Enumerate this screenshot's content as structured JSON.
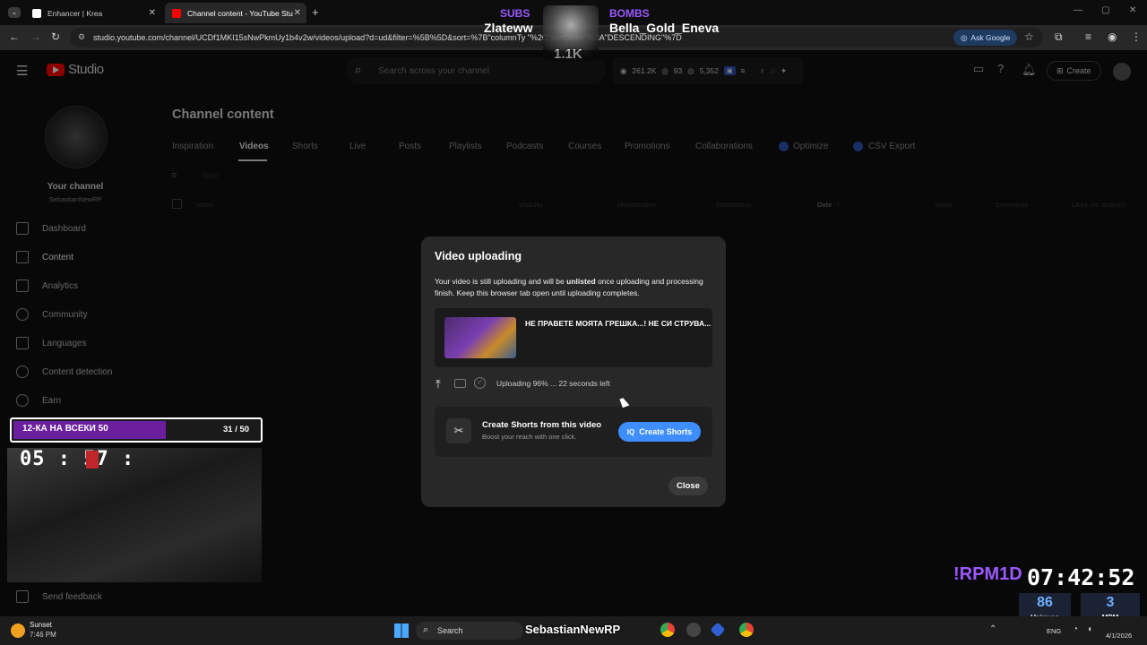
{
  "browser": {
    "tabs": [
      {
        "title": "Enhancer | Krea",
        "color": "#ffffff"
      },
      {
        "title": "Channel content - YouTube Stu",
        "color": "#ff0000"
      }
    ],
    "new_tab": "+",
    "url": "studio.youtube.com/channel/UCDf1MKI15sNwPkmUy1b4v2w/videos/upload?d=ud&filter=%5B%5D&sort=%7B\"columnTy                  \"%2C\"sortOrder\"%3A\"DESCENDING\"%7D",
    "ask_google": "Ask Google"
  },
  "stream_overlay": {
    "subs_label": "SUBS",
    "subs_name": "Zlateww",
    "subs_count": "1.1K",
    "bombs_label": "BOMBS",
    "bombs_name": "Bella_Gold_Eneva"
  },
  "header": {
    "logo": "Studio",
    "search_placeholder": "Search across your channel",
    "stat_views": "261.2K",
    "stat_a": "93",
    "stat_b": "5,352",
    "create_label": "Create"
  },
  "sidebar": {
    "channel_label": "Your channel",
    "channel_name": "SebastianNewRP",
    "items": [
      {
        "label": "Dashboard"
      },
      {
        "label": "Content"
      },
      {
        "label": "Analytics"
      },
      {
        "label": "Community"
      },
      {
        "label": "Languages"
      },
      {
        "label": "Content detection"
      },
      {
        "label": "Earn"
      }
    ],
    "feedback": "Send feedback"
  },
  "main": {
    "title": "Channel content",
    "tabs": [
      "Inspiration",
      "Videos",
      "Shorts",
      "Live",
      "Posts",
      "Playlists",
      "Podcasts",
      "Courses",
      "Promotions",
      "Collaborations",
      "Optimize",
      "CSV Export"
    ],
    "filter": "Filter",
    "columns": [
      "Video",
      "Visibility",
      "Monetization",
      "Restrictions",
      "Date",
      "Views",
      "Comments",
      "Likes (vs. dislikes)"
    ]
  },
  "dialog": {
    "title": "Video uploading",
    "msg_a": "Your video is still uploading and will be ",
    "msg_bold": "unlisted",
    "msg_b": " once uploading and processing",
    "msg_c": "finish. Keep this browser tab open until uploading completes.",
    "video_title": "НЕ ПРАВЕТЕ МОЯТА ГРЕШКА...! НЕ СИ СТРУВА...",
    "status": "Uploading 96% ... 22 seconds left",
    "upload_progress": 0.96,
    "shorts_title": "Create Shorts from this video",
    "shorts_sub": "Boost your reach with one click.",
    "create_shorts": "Create Shorts",
    "close": "Close"
  },
  "goal": {
    "label": "12-КА НА ВСЕКИ 50",
    "count": "31 / 50",
    "progress": 0.62
  },
  "stream_timer": "05 : 57 :",
  "rpm": "!RPM1D",
  "clock": "07:42:52",
  "stats": {
    "uniques_value": "86",
    "uniques_label": "Uniques",
    "mpm_value": "3",
    "mpm_label": "MPM"
  },
  "taskbar": {
    "weather_label": "Sunset",
    "weather_time": "7:46 PM",
    "search": "Search",
    "overlay_name": "SebastianNewRP",
    "lang": "ENG",
    "date": "4/1/2026"
  },
  "colors": {
    "accent": "#3e8eff",
    "purple": "#9b59ff",
    "youtube_red": "#ff0000"
  }
}
